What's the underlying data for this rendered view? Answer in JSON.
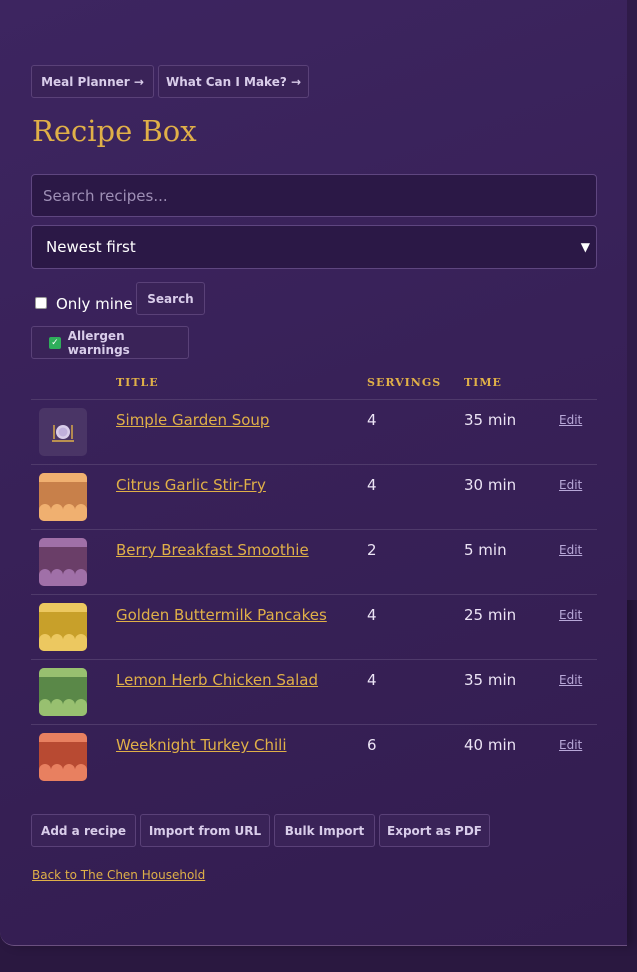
{
  "nav": {
    "meal_planner": "Meal Planner →",
    "what_can_i_make": "What Can I Make? →"
  },
  "page_title": "Recipe Box",
  "search": {
    "placeholder": "Search recipes...",
    "value": ""
  },
  "sort": {
    "selected": "Newest first"
  },
  "filters": {
    "only_mine_label": "Only mine",
    "only_mine_checked": false,
    "search_button": "Search",
    "allergen_label": "Allergen warnings",
    "allergen_checked": true
  },
  "table": {
    "headers": {
      "title": "TITLE",
      "servings": "SERVINGS",
      "time": "TIME"
    },
    "edit_label": "Edit",
    "rows": [
      {
        "title": "Simple Garden Soup",
        "servings": "4",
        "time": "35 min",
        "thumb": "plate-icon"
      },
      {
        "title": "Citrus Garlic Stir-Fry",
        "servings": "4",
        "time": "30 min",
        "thumb_color": "#c8804a",
        "thumb_light": "#f0b070"
      },
      {
        "title": "Berry Breakfast Smoothie",
        "servings": "2",
        "time": "5 min",
        "thumb_color": "#6a3e68",
        "thumb_light": "#a070a8"
      },
      {
        "title": "Golden Buttermilk Pancakes",
        "servings": "4",
        "time": "25 min",
        "thumb_color": "#c8a02a",
        "thumb_light": "#ecc860"
      },
      {
        "title": "Lemon Herb Chicken Salad",
        "servings": "4",
        "time": "35 min",
        "thumb_color": "#5a8848",
        "thumb_light": "#98c070"
      },
      {
        "title": "Weeknight Turkey Chili",
        "servings": "6",
        "time": "40 min",
        "thumb_color": "#b84a32",
        "thumb_light": "#e88060"
      }
    ]
  },
  "actions": {
    "add": "Add a recipe",
    "import_url": "Import from URL",
    "bulk_import": "Bulk Import",
    "export_pdf": "Export as PDF"
  },
  "back_link": "Back to The Chen Household",
  "colors": {
    "accent": "#e0b048",
    "panel": "#3a2358",
    "check_on": "#2fae5b"
  }
}
